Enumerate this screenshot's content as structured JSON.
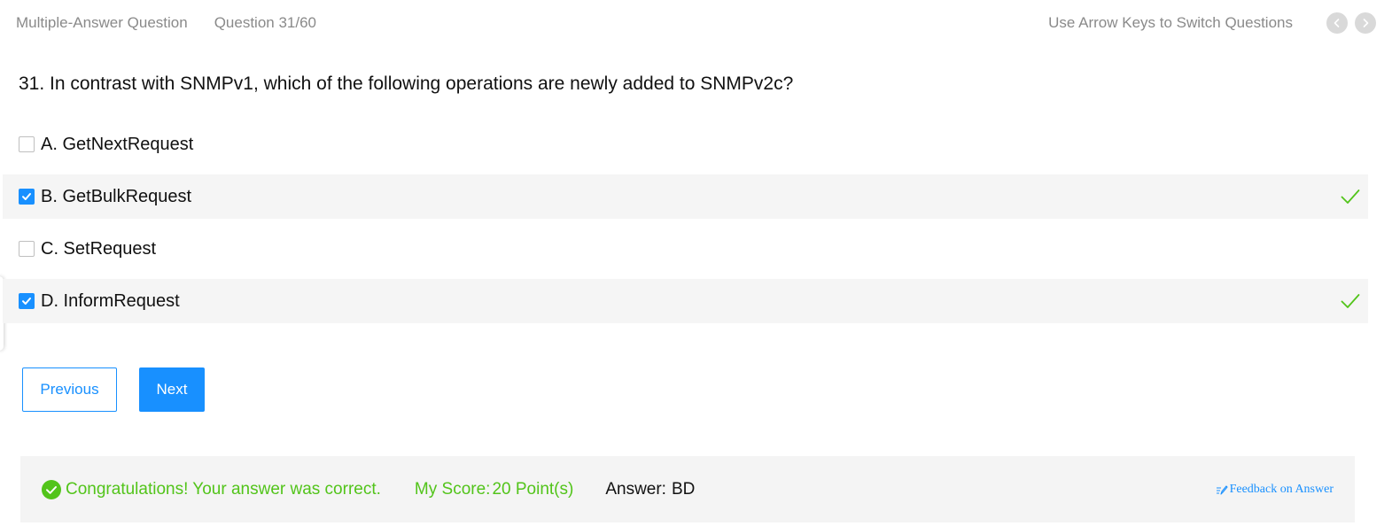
{
  "header": {
    "question_type": "Multiple-Answer Question",
    "progress": "Question 31/60",
    "hint": "Use Arrow Keys to Switch Questions",
    "prev_icon": "chevron-left-icon",
    "next_icon": "chevron-right-icon"
  },
  "question": {
    "text": "31. In contrast with SNMPv1, which of the following operations are newly added to SNMPv2c?"
  },
  "options": [
    {
      "label": "A. GetNextRequest",
      "checked": false,
      "correct_mark": false
    },
    {
      "label": "B. GetBulkRequest",
      "checked": true,
      "correct_mark": true
    },
    {
      "label": "C. SetRequest",
      "checked": false,
      "correct_mark": false
    },
    {
      "label": "D. InformRequest",
      "checked": true,
      "correct_mark": true
    }
  ],
  "buttons": {
    "previous": "Previous",
    "next": "Next"
  },
  "result": {
    "message": "Congratulations! Your answer was correct.",
    "score_label": "My Score:",
    "score_value": "20 Point(s)",
    "answer_label": "Answer:",
    "answer_value": "BD",
    "feedback_link": "Feedback on Answer"
  },
  "colors": {
    "accent": "#1890ff",
    "success": "#52c41a",
    "muted_text": "#8a8a8a",
    "selected_row_bg": "#f5f5f5",
    "result_bg": "#f4f4f4"
  }
}
